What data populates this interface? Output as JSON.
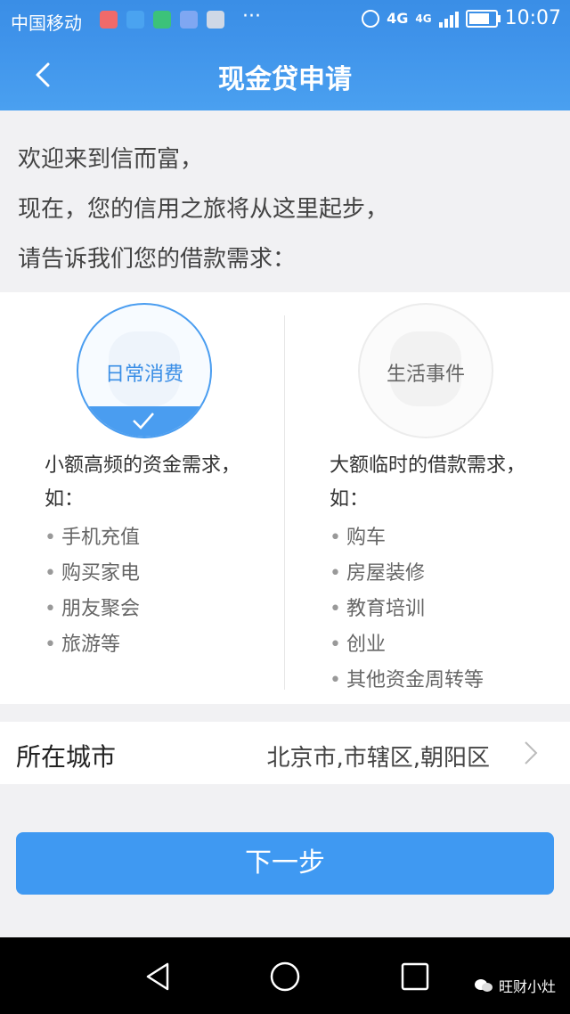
{
  "statusbar": {
    "carrier": "中国移动",
    "dots": "···",
    "network": "4G",
    "network2": "4G",
    "time": "10:07"
  },
  "navbar": {
    "title": "现金贷申请"
  },
  "intro": {
    "line1": "欢迎来到信而富，",
    "line2": "现在，您的信用之旅将从这里起步，",
    "line3": "请告诉我们您的借款需求："
  },
  "options": {
    "left": {
      "label": "日常消费",
      "selected": true,
      "desc1": "小额高频的资金需求，",
      "desc2": "如：",
      "items": [
        "手机充值",
        "购买家电",
        "朋友聚会",
        "旅游等"
      ]
    },
    "right": {
      "label": "生活事件",
      "selected": false,
      "desc1": "大额临时的借款需求，",
      "desc2": "如：",
      "items": [
        "购车",
        "房屋装修",
        "教育培训",
        "创业",
        "其他资金周转等"
      ]
    }
  },
  "city": {
    "label": "所在城市",
    "value": "北京市,市辖区,朝阳区"
  },
  "next_button": "下一步",
  "watermark": "旺财小灶",
  "colors": {
    "accent": "#3f99f2",
    "header": "#3f93ea"
  }
}
